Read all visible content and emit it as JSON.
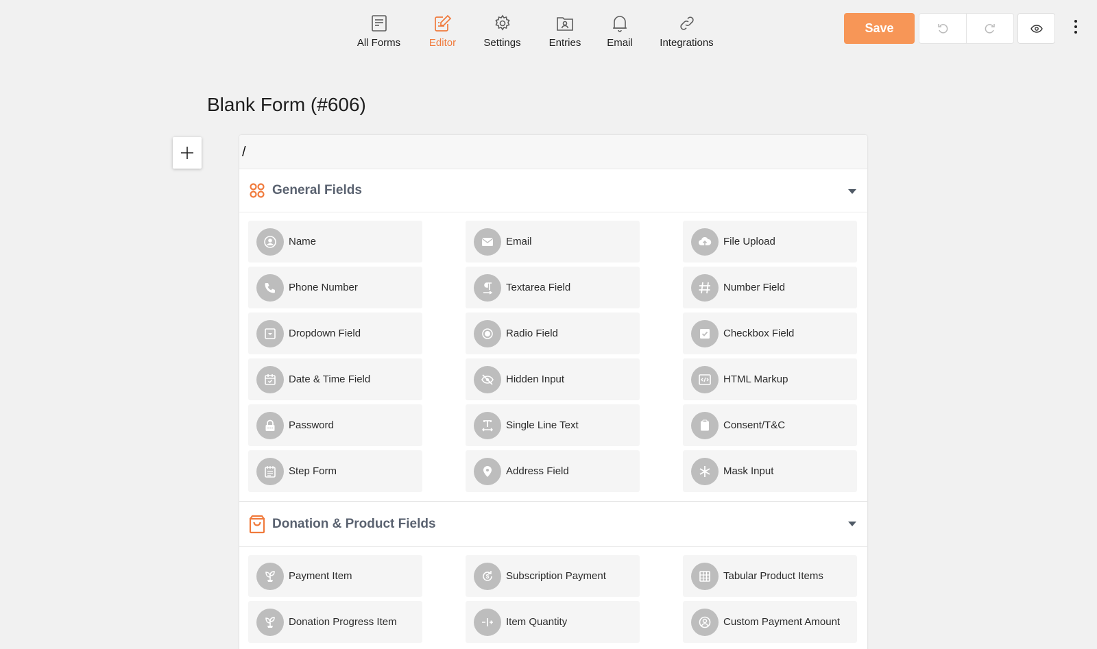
{
  "nav": {
    "items": [
      {
        "label": "All Forms",
        "icon": "forms-icon",
        "active": false
      },
      {
        "label": "Editor",
        "icon": "editor-icon",
        "active": true
      },
      {
        "label": "Settings",
        "icon": "gear-icon",
        "active": false
      },
      {
        "label": "Entries",
        "icon": "entries-icon",
        "active": false
      },
      {
        "label": "Email",
        "icon": "bell-icon",
        "active": false
      },
      {
        "label": "Integrations",
        "icon": "link-icon",
        "active": false
      }
    ]
  },
  "toolbar": {
    "save_label": "Save"
  },
  "colors": {
    "accent": "#f07a3c",
    "save_bg": "#f79657",
    "field_icon_bg": "#bdbdbd",
    "section_title": "#5a6270"
  },
  "page": {
    "title": "Blank Form (#606)"
  },
  "search": {
    "value": "/"
  },
  "sections": {
    "general": {
      "title": "General Fields",
      "icon": "grid-icon",
      "fields": [
        {
          "label": "Name",
          "icon": "user-icon"
        },
        {
          "label": "Email",
          "icon": "envelope-icon"
        },
        {
          "label": "File Upload",
          "icon": "cloud-upload-icon"
        },
        {
          "label": "Phone Number",
          "icon": "phone-icon"
        },
        {
          "label": "Textarea Field",
          "icon": "paragraph-icon"
        },
        {
          "label": "Number Field",
          "icon": "hash-icon"
        },
        {
          "label": "Dropdown Field",
          "icon": "dropdown-icon"
        },
        {
          "label": "Radio Field",
          "icon": "radio-icon"
        },
        {
          "label": "Checkbox Field",
          "icon": "checkbox-icon"
        },
        {
          "label": "Date & Time Field",
          "icon": "calendar-icon"
        },
        {
          "label": "Hidden Input",
          "icon": "eye-off-icon"
        },
        {
          "label": "HTML Markup",
          "icon": "code-icon"
        },
        {
          "label": "Password",
          "icon": "lock-icon"
        },
        {
          "label": "Single Line Text",
          "icon": "text-icon"
        },
        {
          "label": "Consent/T&C",
          "icon": "clipboard-icon"
        },
        {
          "label": "Step Form",
          "icon": "steps-icon"
        },
        {
          "label": "Address Field",
          "icon": "map-pin-icon"
        },
        {
          "label": "Mask Input",
          "icon": "asterisk-icon"
        }
      ]
    },
    "donation": {
      "title": "Donation & Product Fields",
      "icon": "bag-icon",
      "fields": [
        {
          "label": "Payment Item",
          "icon": "plant-icon"
        },
        {
          "label": "Subscription Payment",
          "icon": "subscription-icon"
        },
        {
          "label": "Tabular Product Items",
          "icon": "table-icon"
        },
        {
          "label": "Donation Progress Item",
          "icon": "plant-icon"
        },
        {
          "label": "Item Quantity",
          "icon": "quantity-icon"
        },
        {
          "label": "Custom Payment Amount",
          "icon": "user-circle-icon"
        }
      ]
    }
  }
}
